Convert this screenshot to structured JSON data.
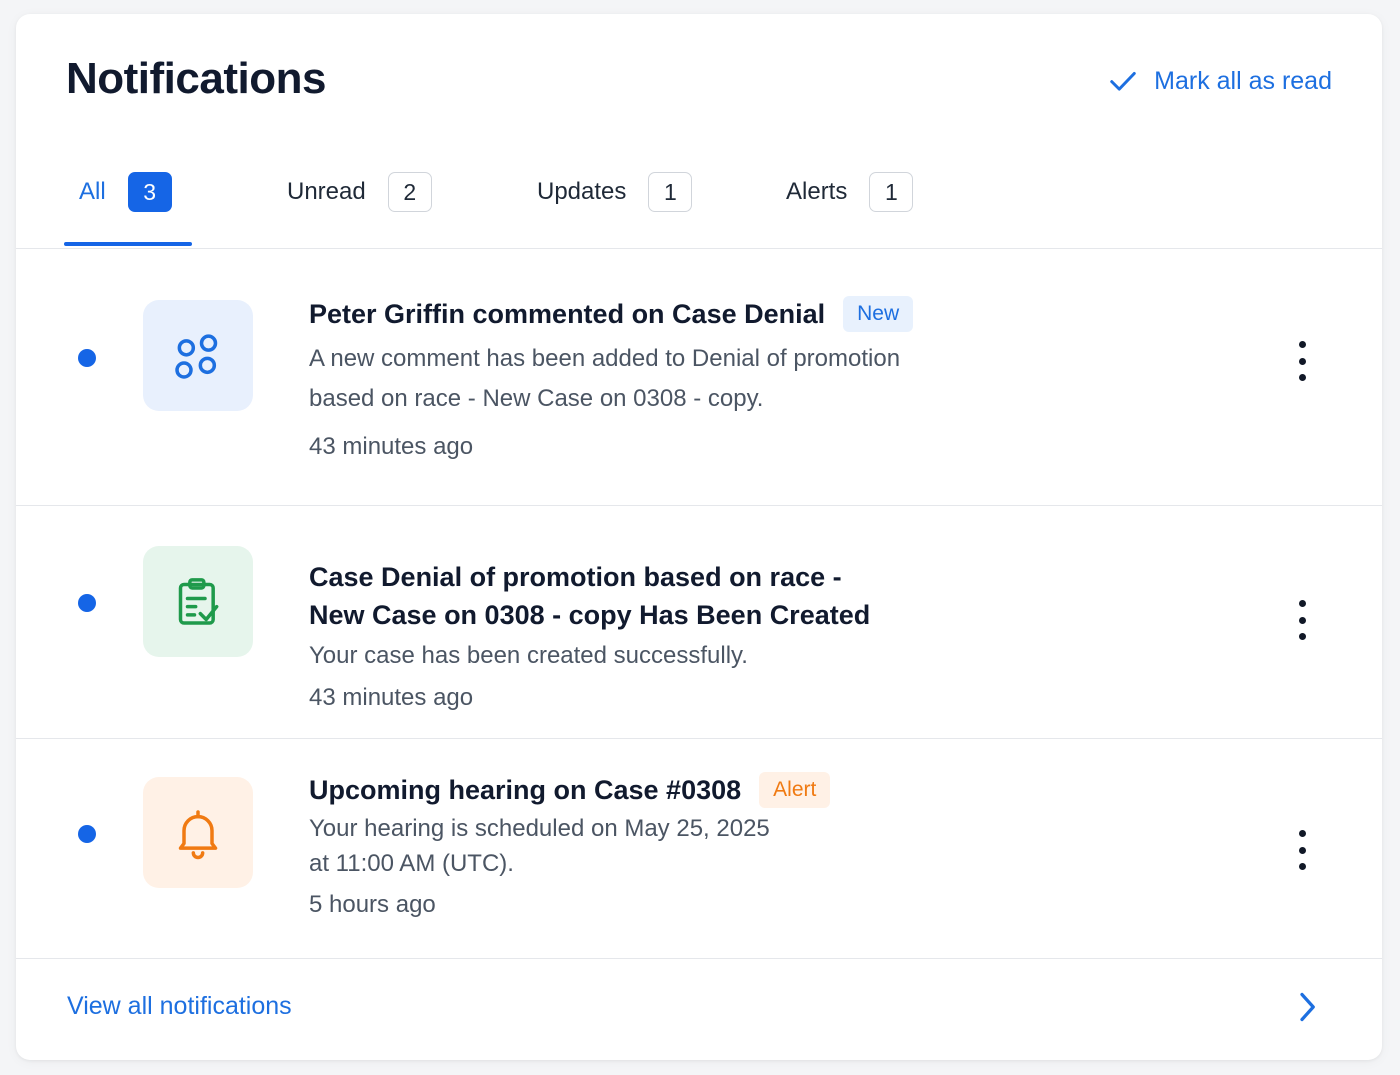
{
  "header": {
    "title": "Notifications",
    "mark_all_label": "Mark all as read"
  },
  "tabs": [
    {
      "label": "All",
      "count": "3",
      "active": true
    },
    {
      "label": "Unread",
      "count": "2"
    },
    {
      "label": "Updates",
      "count": "1"
    },
    {
      "label": "Alerts",
      "count": "1"
    }
  ],
  "notifications": [
    {
      "title": "Peter Griffin commented on Case Denial",
      "badge": "New",
      "desc_line1": "A new comment has been added to Denial of promotion",
      "desc_line2": "based on race - New Case on 0308 - copy.",
      "time": "43 minutes ago",
      "icon": "nodes-icon",
      "unread": true
    },
    {
      "title_line1": "Case Denial of promotion based on race -",
      "title_line2": "New Case on 0308 - copy Has Been Created",
      "desc_line1": "Your case has been created successfully.",
      "time": "43 minutes ago",
      "icon": "clipboard-check-icon",
      "unread": true
    },
    {
      "title": "Upcoming hearing on Case #0308",
      "badge": "Alert",
      "desc_line1": "Your hearing is scheduled on May 25, 2025",
      "desc_line2": "at 11:00 AM (UTC).",
      "time": "5 hours ago",
      "icon": "bell-icon",
      "unread": true
    }
  ],
  "footer": {
    "view_all_label": "View all notifications"
  },
  "colors": {
    "accent": "#1565e6",
    "link": "#1d6fe0",
    "update_icon_bg": "#e8f0fd",
    "success_icon_bg": "#e6f5ec",
    "alert_icon_bg": "#fff1e6",
    "alert_text": "#f07a12"
  }
}
